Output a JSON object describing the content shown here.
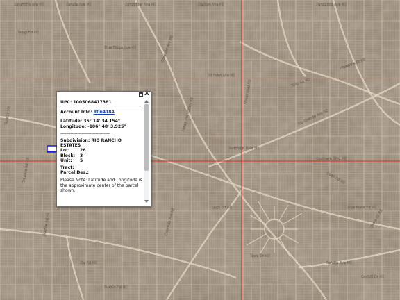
{
  "map": {
    "street_labels": [
      "Saturnino Ave NE",
      "Sandia Ave NE",
      "Sandpiper Ave NE",
      "Stallion Ave NE",
      "Sundance Ave NE",
      "Tokay Rd NE",
      "Blue Ridge Ave NE",
      "Conchas Ave NE",
      "Hiawatha St NE",
      "Hi Point Ave NE",
      "Taos Dr NE",
      "Chamisa Rd NE",
      "Elk Ave NE",
      "Colorado Ave NE",
      "Lago Rd NE",
      "Rio Grande Ave NE",
      "Quail Rd NE",
      "Blue Mesa Rd NE",
      "Cibola Dr NE",
      "Pueblo Rd NE",
      "Southern Blvd NE",
      "Northern Blvd NE",
      "Unser Blvd NE",
      "Paseo Del Volcan NE",
      "Tulip Rd NE",
      "Zia Rd NE",
      "Jicarilla Rd NE",
      "Peralta Ave NE",
      "Cochiti Dr NE",
      "Tewa Dr NE"
    ],
    "colors": {
      "terrain": "#8a7a68",
      "parcel_line": "#d2c6b2",
      "major_road": "#d23a2a",
      "highlight": "#1a1ae0"
    }
  },
  "popup": {
    "upc": "UPC: 1005068417381",
    "account_label": "Account Info:",
    "account_link": "R064184",
    "latitude": "Latitude: 35° 14' 34.154\"",
    "longitude": "Longitude: -106° 48' 3.925\"",
    "dashes": "------------------------------------",
    "subdivision_label": "Subdivision:",
    "subdivision_value": "RIO RANCHO ESTATES",
    "lot_label": "Lot:",
    "lot_value": "26",
    "block_label": "Block:",
    "block_value": "3",
    "unit_label": "Unit:",
    "unit_value": "5",
    "tract_label": "Tract:",
    "parcel_des_label": "Parcel Des.:",
    "note": "Please Note: Latitude and Longitude is the approximate center of the parcel shown.",
    "close_glyph": "X"
  }
}
